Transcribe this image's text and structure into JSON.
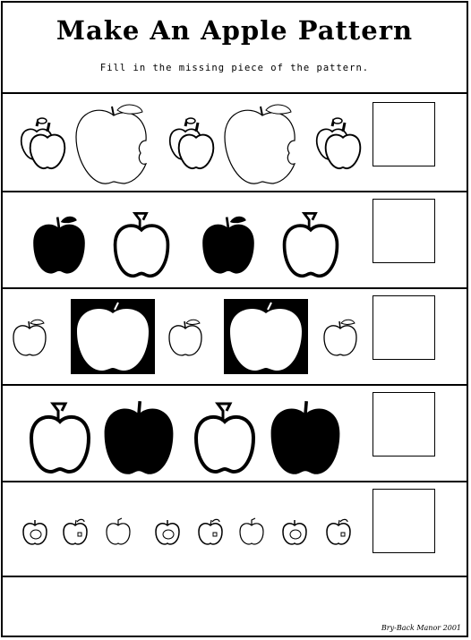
{
  "worksheet": {
    "title": "Make An Apple Pattern",
    "instruction": "Fill in the missing piece of the pattern.",
    "credit": "Bry-Back Manor 2001"
  },
  "rows": [
    {
      "name": "row-1",
      "pattern": [
        "apple-pair-icon",
        "bitten-apple-icon",
        "apple-pair-icon",
        "bitten-apple-icon",
        "apple-pair-icon"
      ]
    },
    {
      "name": "row-2",
      "pattern": [
        "black-apple-icon",
        "outline-apple-icon",
        "black-apple-icon",
        "outline-apple-icon"
      ]
    },
    {
      "name": "row-3",
      "pattern": [
        "small-apple-icon",
        "framed-apple-icon",
        "small-apple-icon",
        "framed-apple-icon",
        "small-apple-icon"
      ]
    },
    {
      "name": "row-4",
      "pattern": [
        "outline-apple-icon",
        "black-apple-icon",
        "outline-apple-icon",
        "black-apple-icon"
      ]
    },
    {
      "name": "row-5",
      "pattern": [
        "tiny-apple-icon",
        "tiny-apple-icon",
        "tiny-apple-icon",
        "tiny-apple-icon",
        "tiny-apple-icon",
        "tiny-apple-icon",
        "tiny-apple-icon",
        "tiny-apple-icon"
      ]
    }
  ]
}
